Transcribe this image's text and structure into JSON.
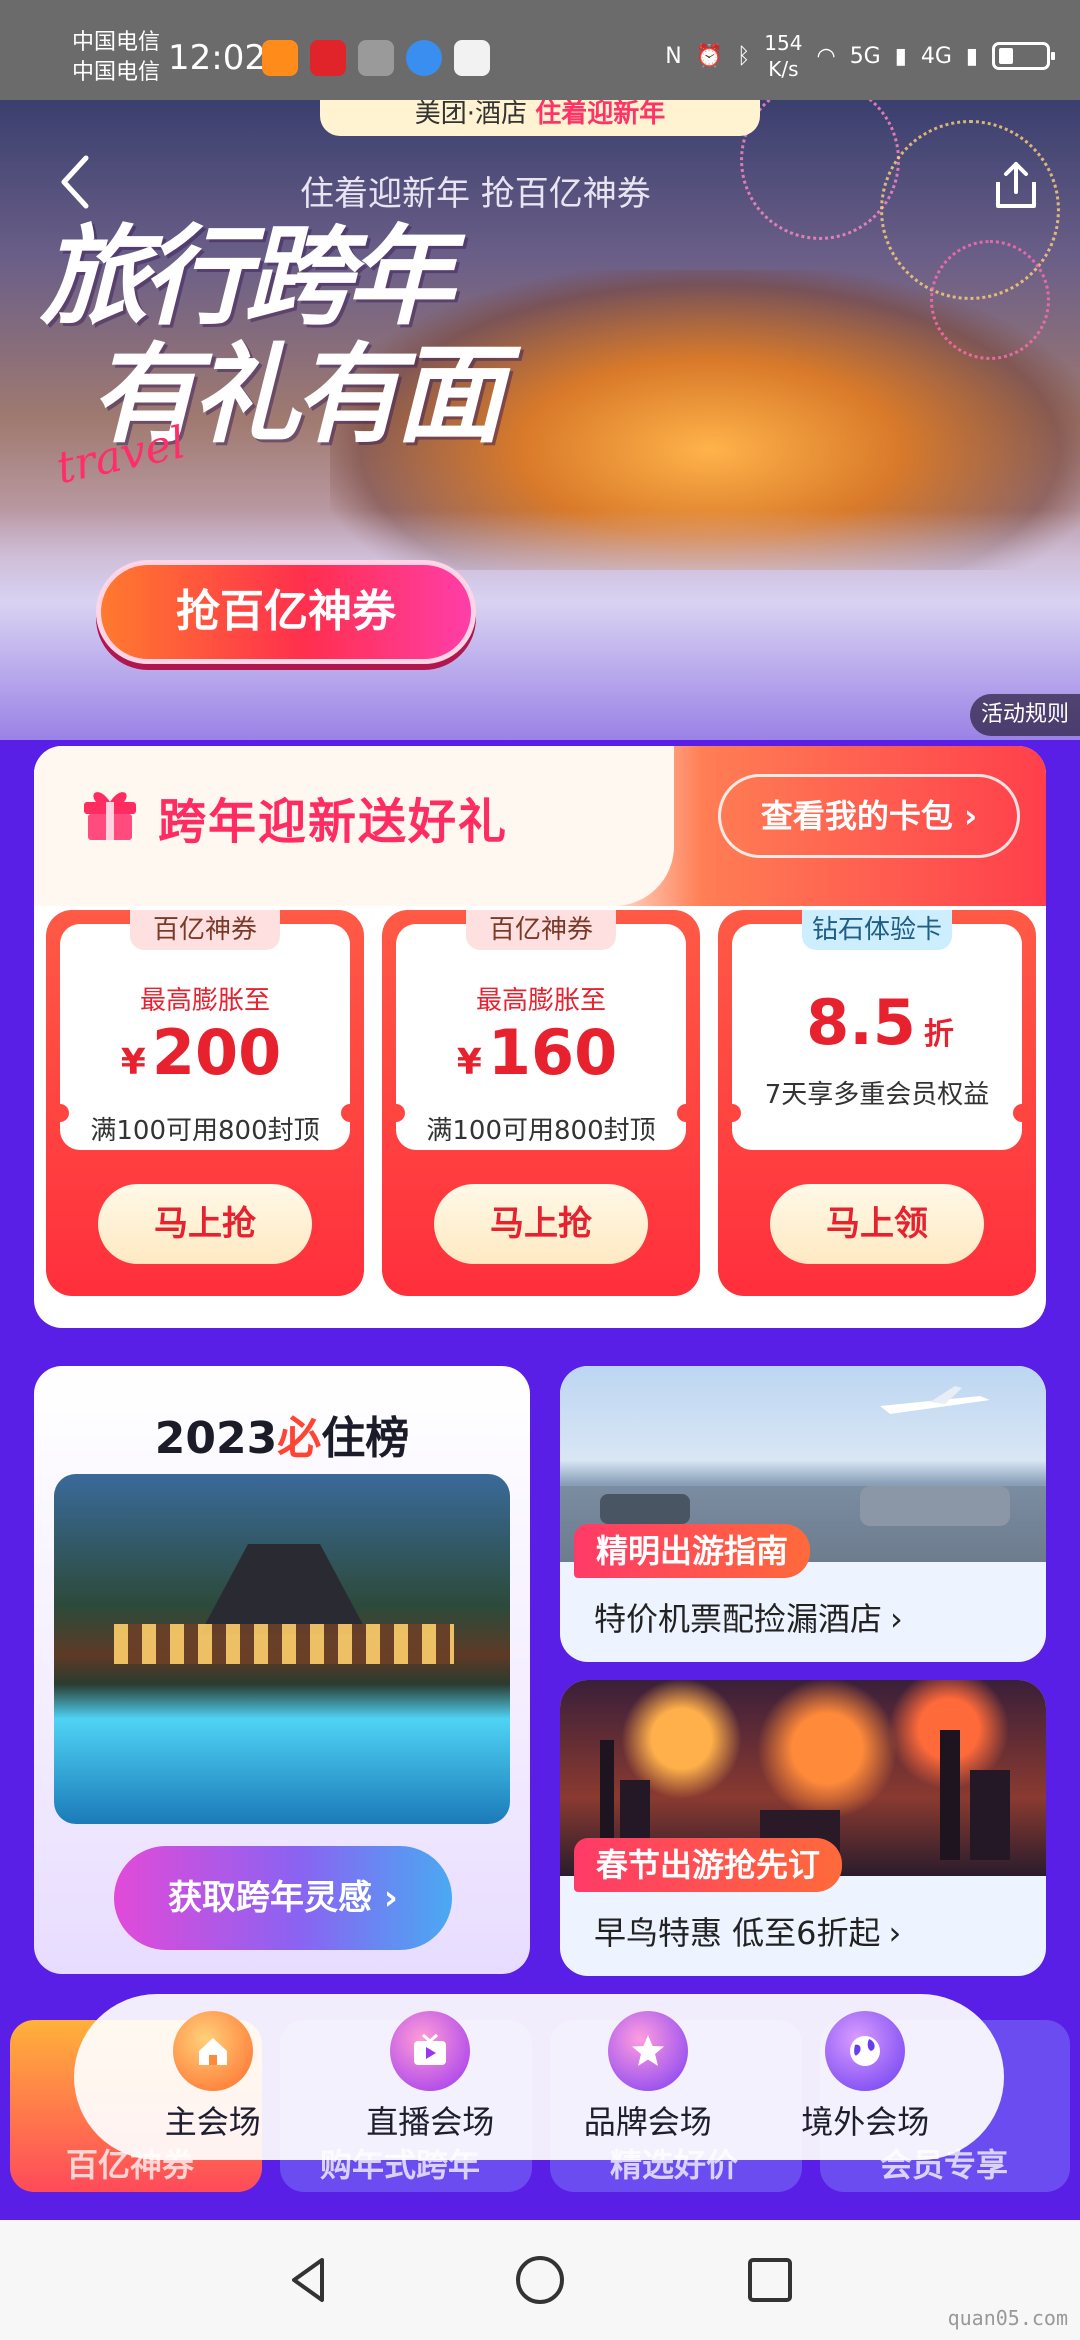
{
  "status_bar": {
    "carrier_1": "中国电信",
    "carrier_2": "中国电信",
    "time": "12:02",
    "net_speed_value": "154",
    "net_speed_unit": "K/s",
    "signal_1": "5G",
    "signal_2": "4G"
  },
  "hero": {
    "brand_left": "美团·酒店",
    "brand_right": "住着迎新年",
    "subtitle": "住着迎新年 抢百亿神券",
    "title_line1": "旅行跨年",
    "title_line2": "有礼有面",
    "travel_script": "travel",
    "cta_label": "抢百亿神券",
    "rules_label": "活动规则"
  },
  "gift_section": {
    "title": "跨年迎新送好礼",
    "wallet_button": "查看我的卡包 ›",
    "coupons": [
      {
        "tag": "百亿神券",
        "subtitle": "最高膨胀至",
        "currency": "¥",
        "amount": "200",
        "unit": "",
        "note": "满100可用800封顶",
        "button": "马上抢"
      },
      {
        "tag": "百亿神券",
        "subtitle": "最高膨胀至",
        "currency": "¥",
        "amount": "160",
        "unit": "",
        "note": "满100可用800封顶",
        "button": "马上抢"
      },
      {
        "tag": "钻石体验卡",
        "subtitle": "",
        "currency": "",
        "amount": "8.5",
        "unit": "折",
        "note": "7天享多重会员权益",
        "button": "马上领"
      }
    ]
  },
  "promos": {
    "ranking_year": "2023",
    "ranking_mark": "必",
    "ranking_word": "住榜",
    "ranking_button": "获取跨年灵感 ›",
    "guide_tag": "精明出游指南",
    "guide_desc": "特价机票配捡漏酒店",
    "spring_tag": "春节出游抢先订",
    "spring_desc": "早鸟特惠 低至6折起",
    "chevron": "›"
  },
  "venue_nav": {
    "items": [
      {
        "label": "主会场",
        "icon": "home-icon",
        "active": true
      },
      {
        "label": "直播会场",
        "icon": "tv-icon",
        "active": false
      },
      {
        "label": "品牌会场",
        "icon": "star-icon",
        "active": false
      },
      {
        "label": "境外会场",
        "icon": "globe-icon",
        "active": false
      }
    ],
    "under_labels": [
      "百亿神券",
      "购年式跨年",
      "精选好价",
      "会员专享"
    ]
  },
  "watermark": "quan05.com",
  "colors": {
    "page_bg": "#5a1fe6",
    "accent_red": "#ff2c62",
    "coupon_red": "#ff2f3c",
    "cta_orange": "#ff7a2e"
  }
}
